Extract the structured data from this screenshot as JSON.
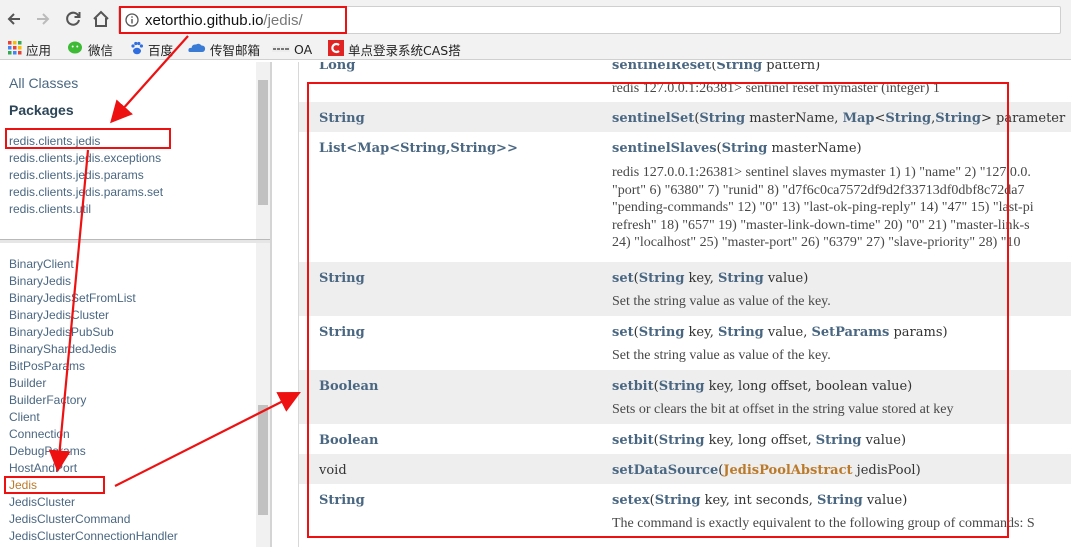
{
  "browser": {
    "url_host": "xetorthio.github.io",
    "url_path": "/jedis/",
    "bookmarks": [
      {
        "label": "应用",
        "icon": "apps-grid-icon"
      },
      {
        "label": "微信",
        "icon": "wechat-icon"
      },
      {
        "label": "百度",
        "icon": "baidu-paw-icon"
      },
      {
        "label": "传智邮箱",
        "icon": "mail-cloud-icon"
      },
      {
        "label": "OA",
        "icon": "oa-icon"
      },
      {
        "label": "单点登录系统CAS搭",
        "icon": "cas-icon"
      }
    ]
  },
  "packages_frame": {
    "all_classes": "All Classes",
    "title": "Packages",
    "items": [
      "redis.clients.jedis",
      "redis.clients.jedis.exceptions",
      "redis.clients.jedis.params",
      "redis.clients.jedis.params.set",
      "redis.clients.util"
    ]
  },
  "classes_frame": {
    "items": [
      "BinaryClient",
      "BinaryJedis",
      "BinaryJedisSetFromList",
      "BinaryJedisCluster",
      "BinaryJedisPubSub",
      "BinaryShardedJedis",
      "BitPosParams",
      "Builder",
      "BuilderFactory",
      "Client",
      "Connection",
      "DebugParams",
      "HostAndPort",
      "Jedis",
      "JedisCluster",
      "JedisClusterCommand",
      "JedisClusterConnectionHandler"
    ],
    "active_item": "Jedis"
  },
  "methods": [
    {
      "type": "Long",
      "sig_name": "sentinelReset",
      "sig_rest": "(String  pattern)",
      "desc": "redis 127.0.0.1:26381> sentinel reset mymaster (integer) 1"
    },
    {
      "type": "String",
      "sig_name": "sentinelSet",
      "sig_rest": "(String  masterName, Map<String,String>  parameter",
      "desc": ""
    },
    {
      "type": "List<Map<String,String>>",
      "sig_name": "sentinelSlaves",
      "sig_rest": "(String  masterName)",
      "desc_lines": [
        "redis 127.0.0.1:26381> sentinel slaves mymaster 1) 1) \"name\" 2) \"127.0.0.",
        "\"port\" 6) \"6380\" 7) \"runid\" 8) \"d7f6c0ca7572df9d2f33713df0dbf8c72da7",
        "\"pending-commands\" 12) \"0\" 13) \"last-ok-ping-reply\" 14) \"47\" 15) \"last-pi",
        "refresh\" 18) \"657\" 19) \"master-link-down-time\" 20) \"0\" 21) \"master-link-s",
        "24) \"localhost\" 25) \"master-port\" 26) \"6379\" 27) \"slave-priority\" 28) \"10"
      ]
    },
    {
      "type": "String",
      "sig_name": "set",
      "sig_rest": "(String  key, String  value)",
      "desc": "Set the string value as value of the key."
    },
    {
      "type": "String",
      "sig_name": "set",
      "sig_rest": "(String  key, String  value, SetParams  params)",
      "desc": "Set the string value as value of the key."
    },
    {
      "type": "Boolean",
      "sig_name": "setbit",
      "sig_rest": "(String  key, long  offset, boolean  value)",
      "desc": "Sets or clears the bit at offset in the string value stored at key"
    },
    {
      "type": "Boolean",
      "sig_name": "setbit",
      "sig_rest": "(String  key, long  offset, String  value)",
      "desc": ""
    },
    {
      "type": "void",
      "sig_name": "setDataSource",
      "sig_rest": "(JedisPoolAbstract  jedisPool)",
      "desc": ""
    },
    {
      "type": "String",
      "sig_name": "setex",
      "sig_rest": "(String  key, int  seconds, String  value)",
      "desc": "The command is exactly equivalent to the following group of commands: S"
    }
  ],
  "colors": {
    "annotation_red": "#ee1111",
    "link_blue": "#4a6782",
    "active_orange": "#bb7a2a"
  }
}
